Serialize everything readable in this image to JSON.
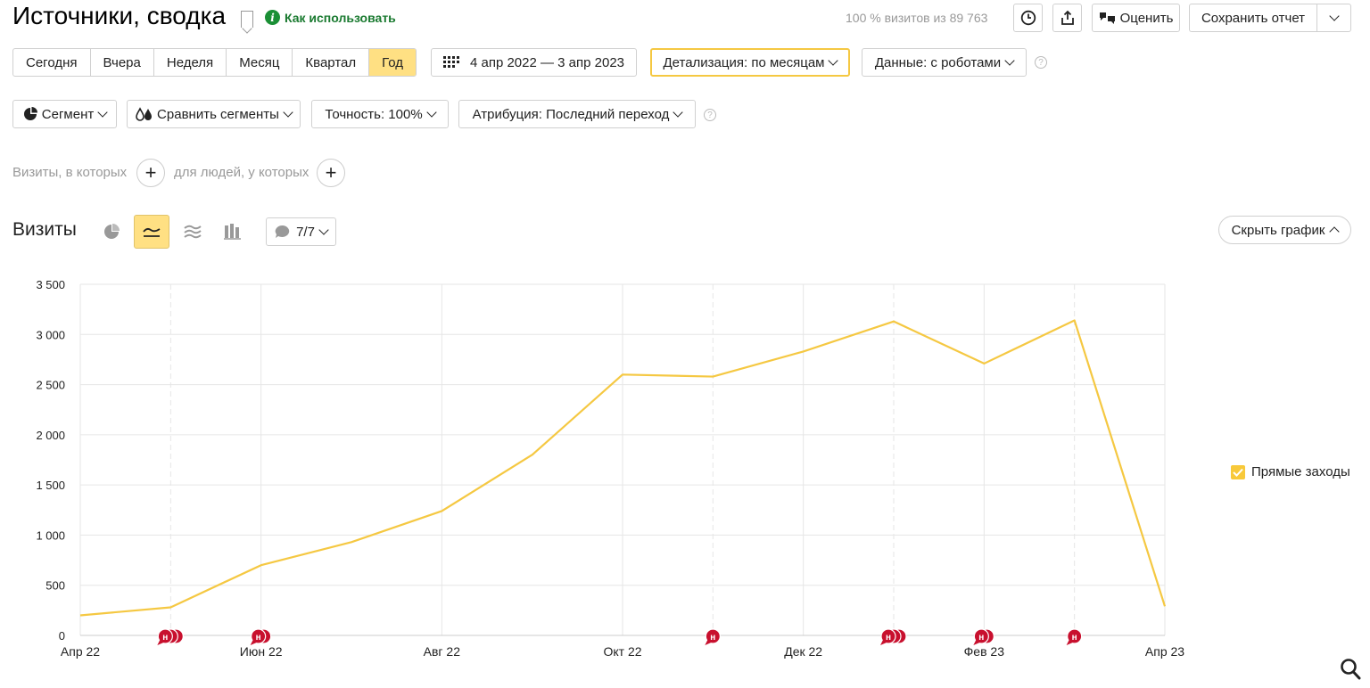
{
  "header": {
    "title": "Источники, сводка",
    "how_to_use": "Как использовать",
    "visits_info": "100 % визитов из 89 763",
    "rate_label": "Оценить",
    "save_report_label": "Сохранить отчет"
  },
  "periods": [
    "Сегодня",
    "Вчера",
    "Неделя",
    "Месяц",
    "Квартал",
    "Год"
  ],
  "active_period": "Год",
  "date_range": "4 апр 2022 — 3 апр 2023",
  "detail": "Детализация: по месяцам",
  "data_mode": "Данные: с роботами",
  "segment_label": "Сегмент",
  "compare_label": "Сравнить сегменты",
  "accuracy_label": "Точность: 100%",
  "attribution_label": "Атрибуция: Последний переход",
  "filters": {
    "visits_text": "Визиты, в которых",
    "people_text": "для людей, у которых"
  },
  "chart_header": {
    "title": "Визиты",
    "annotations_count": "7/7",
    "hide_chart_label": "Скрыть график"
  },
  "chart_data": {
    "type": "line",
    "title": "",
    "xlabel": "",
    "ylabel": "",
    "ylim": [
      0,
      3500
    ],
    "yticks": [
      0,
      500,
      1000,
      1500,
      2000,
      2500,
      3000,
      3500
    ],
    "ytick_labels": [
      "0",
      "500",
      "1 000",
      "1 500",
      "2 000",
      "2 500",
      "3 000",
      "3 500"
    ],
    "x": [
      "Апр 22",
      "Май 22",
      "Июн 22",
      "Июл 22",
      "Авг 22",
      "Сен 22",
      "Окт 22",
      "Ноя 22",
      "Дек 22",
      "Янв 23",
      "Фев 23",
      "Мар 23",
      "Апр 23"
    ],
    "xtick_labels": [
      "Апр 22",
      "Июн 22",
      "Авг 22",
      "Окт 22",
      "Дек 22",
      "Фев 23",
      "Апр 23"
    ],
    "series": [
      {
        "name": "Прямые заходы",
        "color": "#f5c842",
        "values": [
          200,
          280,
          700,
          930,
          1240,
          1800,
          2600,
          2580,
          2830,
          3130,
          2710,
          3140,
          290
        ]
      }
    ],
    "annotations": [
      {
        "x": "Май 22",
        "count": 3,
        "label": "н"
      },
      {
        "x": "Июн 22",
        "count": 2,
        "label": "н"
      },
      {
        "x": "Ноя 22",
        "count": 1,
        "label": "н"
      },
      {
        "x": "Янв 23",
        "count": 3,
        "label": "н"
      },
      {
        "x": "Фев 23",
        "count": 2,
        "label": "н"
      },
      {
        "x": "Мар 23",
        "count": 1,
        "label": "н"
      }
    ],
    "grid": true,
    "legend": "right"
  },
  "colors": {
    "accent": "#ffe083",
    "line": "#f5c842",
    "annotation": "#c8102e",
    "link_green": "#1a7a30"
  }
}
